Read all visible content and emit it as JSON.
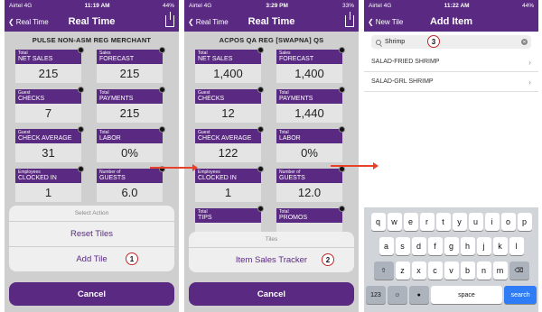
{
  "phone1": {
    "status": {
      "carrier": "Airtel",
      "network": "4G",
      "time": "11:19 AM",
      "battery": "44%"
    },
    "nav": {
      "back": "Real Time",
      "title": "Real Time"
    },
    "store": "PULSE NON-ASM REG MERCHANT",
    "tiles": [
      {
        "sub": "Total",
        "label": "NET SALES",
        "value": "215"
      },
      {
        "sub": "Sales",
        "label": "FORECAST",
        "value": "215"
      },
      {
        "sub": "Guest",
        "label": "CHECKS",
        "value": "7"
      },
      {
        "sub": "Total",
        "label": "PAYMENTS",
        "value": "215"
      },
      {
        "sub": "Guest",
        "label": "CHECK AVERAGE",
        "value": "31"
      },
      {
        "sub": "Total",
        "label": "LABOR",
        "value": "0%"
      },
      {
        "sub": "Employees",
        "label": "CLOCKED IN",
        "value": "1"
      },
      {
        "sub": "Number of",
        "label": "GUESTS",
        "value": "6.0"
      }
    ],
    "sheet": {
      "header": "Select Action",
      "options": [
        "Reset Tiles",
        "Add Tile"
      ]
    },
    "cancel": "Cancel",
    "badge": "1"
  },
  "phone2": {
    "status": {
      "carrier": "Airtel",
      "network": "4G",
      "time": "3:29 PM",
      "battery": "33%"
    },
    "nav": {
      "back": "Real Time",
      "title": "Real Time"
    },
    "store": "ACPOS QA REG [SWAPNA] QS",
    "tiles": [
      {
        "sub": "Total",
        "label": "NET SALES",
        "value": "1,400"
      },
      {
        "sub": "Sales",
        "label": "FORECAST",
        "value": "1,400"
      },
      {
        "sub": "Guest",
        "label": "CHECKS",
        "value": "12"
      },
      {
        "sub": "Total",
        "label": "PAYMENTS",
        "value": "1,440"
      },
      {
        "sub": "Guest",
        "label": "CHECK AVERAGE",
        "value": "122"
      },
      {
        "sub": "Total",
        "label": "LABOR",
        "value": "0%"
      },
      {
        "sub": "Employees",
        "label": "CLOCKED IN",
        "value": "1"
      },
      {
        "sub": "Number of",
        "label": "GUESTS",
        "value": "12.0"
      },
      {
        "sub": "Total",
        "label": "TIPS",
        "value": ""
      },
      {
        "sub": "Total",
        "label": "PROMOS",
        "value": ""
      }
    ],
    "sheet": {
      "header": "Tiles",
      "options": [
        "Item Sales Tracker"
      ]
    },
    "cancel": "Cancel",
    "badge": "2"
  },
  "phone3": {
    "status": {
      "carrier": "Airtel",
      "network": "4G",
      "time": "11:22 AM",
      "battery": "44%"
    },
    "nav": {
      "back": "New Tile",
      "title": "Add Item"
    },
    "search": {
      "value": "Shrimp"
    },
    "results": [
      "SALAD-FRIED SHRIMP",
      "SALAD-GRL SHRIMP"
    ],
    "badge": "3",
    "keyboard": {
      "row1": [
        "q",
        "w",
        "e",
        "r",
        "t",
        "y",
        "u",
        "i",
        "o",
        "p"
      ],
      "row2": [
        "a",
        "s",
        "d",
        "f",
        "g",
        "h",
        "j",
        "k",
        "l"
      ],
      "row3": [
        "z",
        "x",
        "c",
        "v",
        "b",
        "n",
        "m"
      ],
      "numbers": "123",
      "space": "space",
      "search": "search"
    }
  },
  "colors": {
    "brand": "#5a2a82",
    "arrow": "#e8412a",
    "badge_ring": "#c0282d",
    "search_key": "#2f7df6"
  }
}
